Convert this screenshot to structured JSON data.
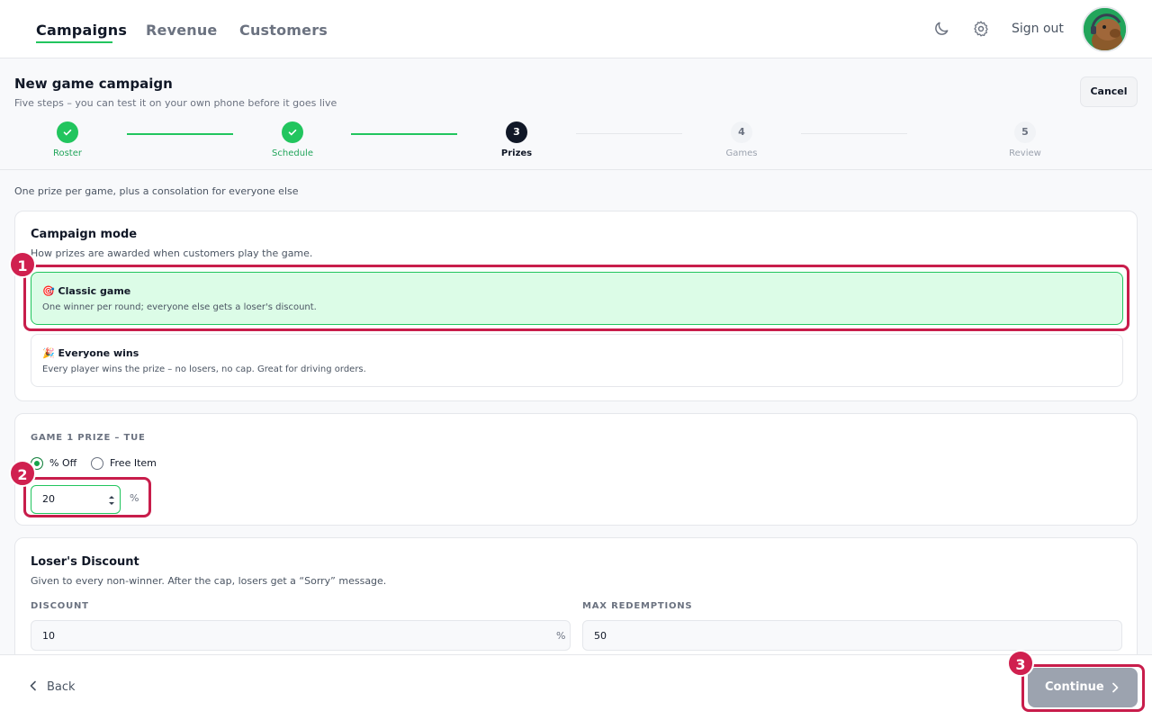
{
  "nav": {
    "tabs": [
      "Campaigns",
      "Revenue",
      "Customers"
    ],
    "sign_out": "Sign out"
  },
  "header": {
    "title": "New game campaign",
    "subtitle": "Five steps – you can test it on your own phone before it goes live",
    "cancel": "Cancel"
  },
  "stepper": {
    "steps": [
      {
        "num": "1",
        "label": "Roster",
        "state": "done"
      },
      {
        "num": "2",
        "label": "Schedule",
        "state": "done"
      },
      {
        "num": "3",
        "label": "Prizes",
        "state": "current"
      },
      {
        "num": "4",
        "label": "Games",
        "state": "todo"
      },
      {
        "num": "5",
        "label": "Review",
        "state": "todo"
      }
    ]
  },
  "info": "One prize per game, plus a consolation for everyone else",
  "mode": {
    "title": "Campaign mode",
    "subtitle": "How prizes are awarded when customers play the game.",
    "options": [
      {
        "icon": "🎯",
        "title": "Classic game",
        "desc": "One winner per round; everyone else gets a loser's discount.",
        "selected": true
      },
      {
        "icon": "🎉",
        "title": "Everyone wins",
        "desc": "Every player wins the prize – no losers, no cap. Great for driving orders.",
        "selected": false
      }
    ]
  },
  "prize": {
    "label": "GAME 1 PRIZE – TUE",
    "radio_pct": "% Off",
    "radio_free": "Free Item",
    "value": "20",
    "unit": "%"
  },
  "loser": {
    "title": "Loser's Discount",
    "subtitle": "Given to every non-winner. After the cap, losers get a “Sorry” message.",
    "discount_label": "DISCOUNT",
    "discount_value": "10",
    "discount_unit": "%",
    "max_label": "MAX REDEMPTIONS",
    "max_value": "50"
  },
  "footer": {
    "back": "Back",
    "continue": "Continue"
  },
  "annotations": [
    "1",
    "2",
    "3"
  ],
  "colors": {
    "accent": "#22c55e",
    "annotation": "#c81d4b",
    "selected_bg": "#dcfce7"
  }
}
